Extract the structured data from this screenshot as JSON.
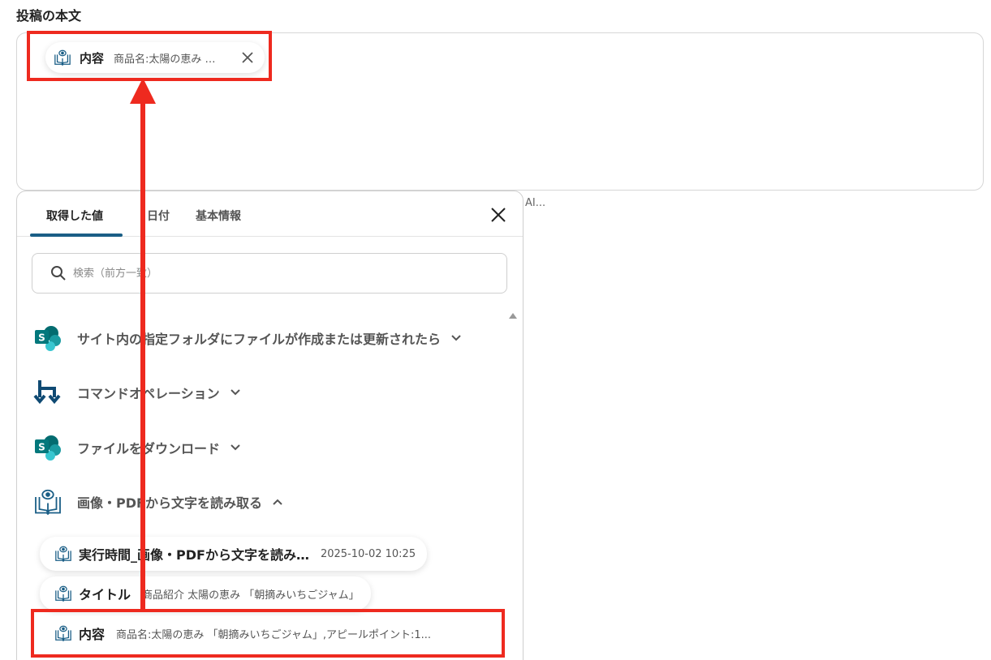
{
  "field": {
    "label": "投稿の本文",
    "hint": "AI..."
  },
  "body_chip": {
    "key": "内容",
    "value": "商品名:太陽の恵み …",
    "icon": "ocr-book-icon"
  },
  "panel": {
    "tabs": [
      "取得した値",
      "日付",
      "基本情報"
    ],
    "active_tab": 0,
    "search_placeholder": "検索（前方一致）",
    "groups": [
      {
        "title": "サイト内の指定フォルダにファイルが作成または更新されたら",
        "icon": "sharepoint-icon",
        "expanded": false
      },
      {
        "title": "コマンドオペレーション",
        "icon": "command-operation-icon",
        "expanded": false
      },
      {
        "title": "ファイルをダウンロード",
        "icon": "sharepoint-icon",
        "expanded": false
      },
      {
        "title": "画像・PDFから文字を読み取る",
        "icon": "ocr-book-icon",
        "expanded": true
      }
    ],
    "items": [
      {
        "key": "実行時間_画像・PDFから文字を読み…",
        "value": "2025-10-02 10:25"
      },
      {
        "key": "タイトル",
        "value": "商品紹介 太陽の恵み 「朝摘みいちごジャム」"
      },
      {
        "key": "内容",
        "value": "商品名:太陽の恵み 「朝摘みいちごジャム」,アピールポイント:1..."
      }
    ]
  },
  "colors": {
    "accent": "#1a5e86",
    "annotation": "#ee2a1f",
    "sharepoint": "#03787c"
  }
}
